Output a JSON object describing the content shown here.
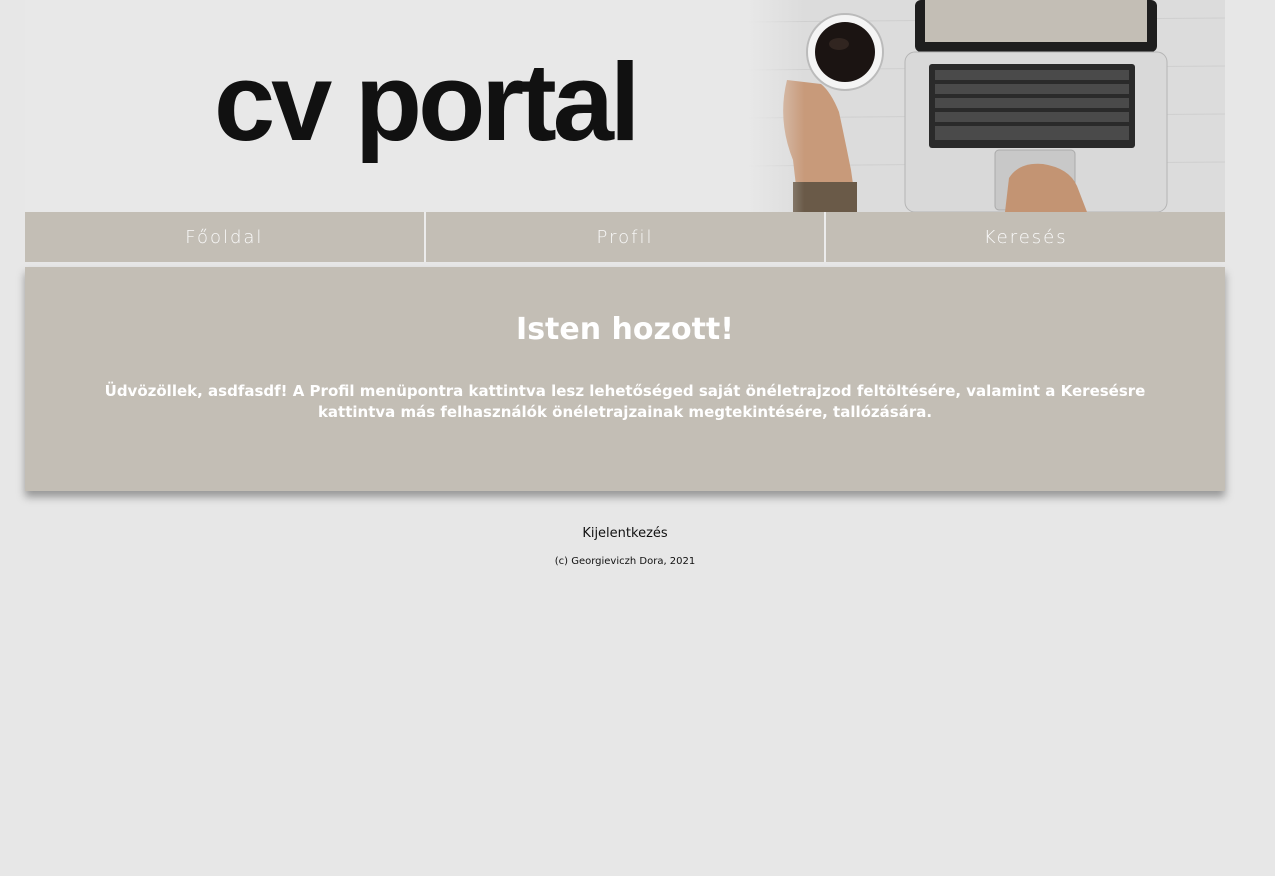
{
  "header": {
    "logo_text": "cv portal",
    "hero_image": "laptop-coffee-photo"
  },
  "nav": {
    "items": [
      {
        "label": "Főoldal"
      },
      {
        "label": "Profil"
      },
      {
        "label": "Keresés"
      }
    ]
  },
  "main": {
    "heading": "Isten hozott!",
    "welcome_text": "Üdvözöllek, asdfasdf! A Profil menüpontra kattintva lesz lehetőséged saját önéletrajzod feltöltésére, valamint a Keresésre kattintva más felhasználók önéletrajzainak megtekintésére, tallózására."
  },
  "footer": {
    "logout_label": "Kijelentkezés",
    "copyright": "(c) Georgieviczh Dora, 2021"
  },
  "colors": {
    "background": "#e7e7e7",
    "panel": "#c3beb5",
    "panel_text": "#ffffff"
  }
}
